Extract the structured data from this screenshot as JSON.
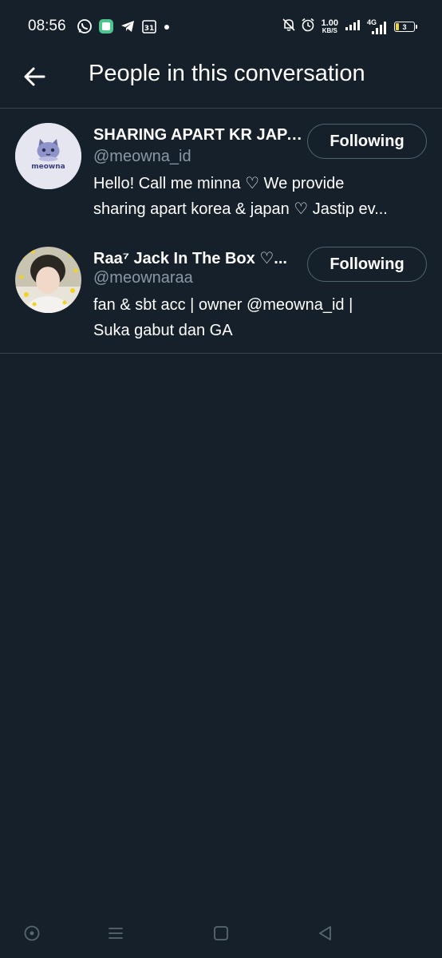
{
  "status_bar": {
    "time": "08:56",
    "left_icons": [
      "whatsapp-icon",
      "messages-icon",
      "telegram-icon",
      "calendar-icon",
      "dot-icon"
    ],
    "calendar_day": "31",
    "net_speed_value": "1.00",
    "net_speed_unit": "KB/S",
    "network_type": "4G",
    "battery_level": "3"
  },
  "header": {
    "title": "People in this conversation"
  },
  "users": [
    {
      "name": "SHARING APART KR JAPAN",
      "handle": "@meowna_id",
      "bio_lines": [
        "Hello! Call me minna ♡ We provide",
        "sharing apart korea & japan ♡ Jastip ev..."
      ],
      "follow_label": "Following",
      "avatar_label": "meowna"
    },
    {
      "name": "Raa⁷ Jack In The Box ♡...",
      "handle": "@meownaraa",
      "bio_lines": [
        "fan & sbt acc | owner @meowna_id |",
        "Suka gabut dan GA"
      ],
      "follow_label": "Following"
    }
  ],
  "colors": {
    "background": "#15202b",
    "divider": "#38444d",
    "secondary_text": "#8b98a5",
    "button_border": "#536471"
  },
  "nav": [
    "assistant-icon",
    "menu-icon",
    "home-square-icon",
    "back-triangle-icon"
  ]
}
